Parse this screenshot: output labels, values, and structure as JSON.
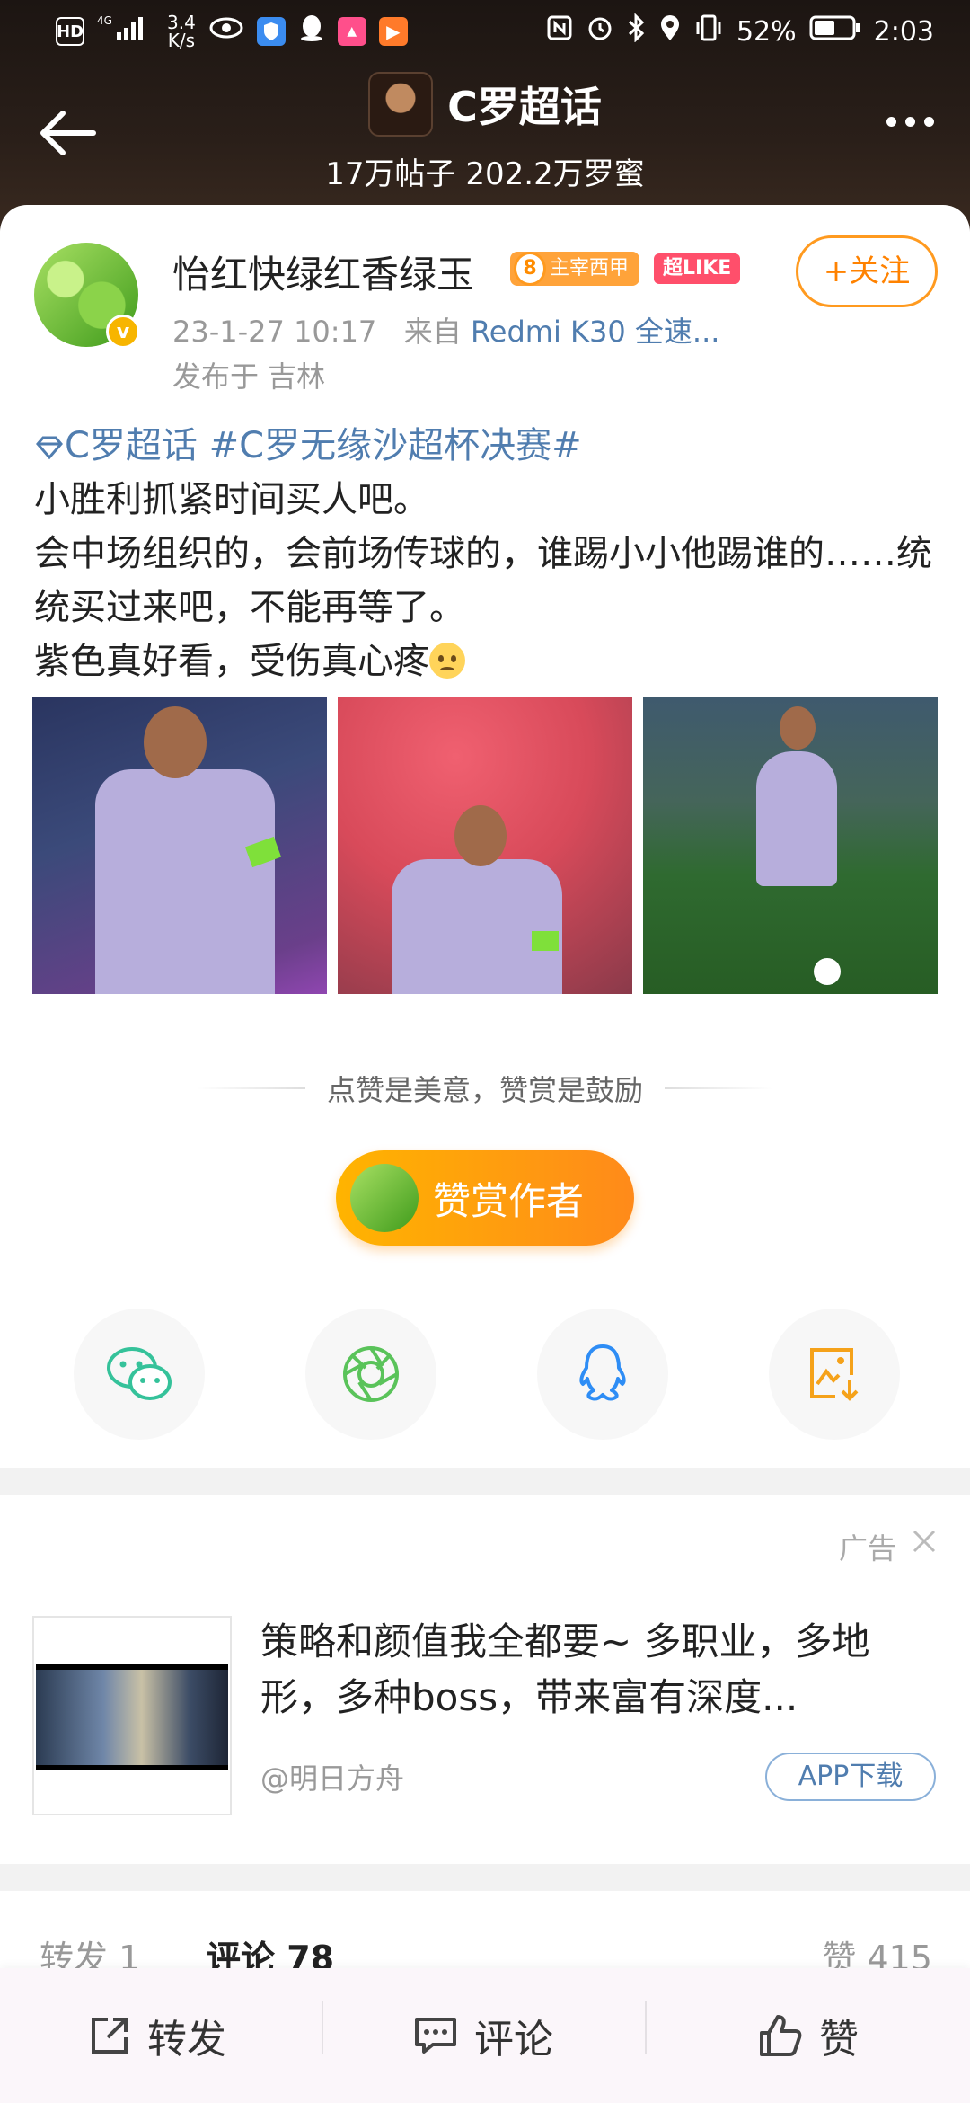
{
  "status_bar": {
    "hd_label": "HD",
    "net_speed": "3.4",
    "net_unit": "K/s",
    "signal_label": "4G",
    "battery": "52%",
    "time": "2:03"
  },
  "header": {
    "title": "C罗超话",
    "stats": "17万帖子  202.2万罗蜜"
  },
  "post": {
    "username": "怡红快绿红香绿玉",
    "level_number": "8",
    "level_badge": "主宰西甲",
    "super_like_badge": "超LIKE",
    "follow_label": "+关注",
    "timestamp": "23-1-27 10:17",
    "source_prefix": "来自",
    "source": "Redmi K30 全速...",
    "location": "发布于 吉林",
    "topic_tags": "C罗超话 #C罗无缘沙超杯决赛#",
    "lines": [
      "小胜利抓紧时间买人吧。",
      "会中场组织的，会前场传球的，谁踢小小他踢谁的……统统买过来吧，不能再等了。",
      "紫色真好看，受伤真心疼"
    ],
    "tip_text": "点赞是美意，赞赏是鼓励",
    "reward_label": "赞赏作者"
  },
  "share_icons": [
    "wechat-icon",
    "moments-icon",
    "qq-icon",
    "save-image-icon"
  ],
  "ad": {
    "label": "广告",
    "text": "策略和颜值我全都要~ 多职业，多地形，多种boss，带来富有深度...",
    "advertiser": "@明日方舟",
    "button": "APP下载"
  },
  "stats": {
    "forward": "转发 1",
    "comment": "评论 78",
    "like": "赞 415"
  },
  "bottom_bar": {
    "forward": "转发",
    "comment": "评论",
    "like": "赞"
  },
  "colors": {
    "link_blue": "#507daf",
    "accent_orange": "#ff8200"
  }
}
